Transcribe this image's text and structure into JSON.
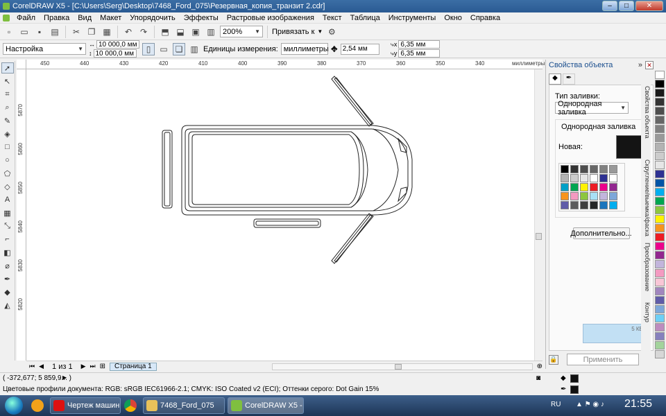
{
  "window": {
    "title": "CorelDRAW X5 - [C:\\Users\\Serg\\Desktop\\7468_Ford_075\\Резервная_копия_транзит 2.cdr]"
  },
  "menu": [
    "Файл",
    "Правка",
    "Вид",
    "Макет",
    "Упорядочить",
    "Эффекты",
    "Растровые изображения",
    "Текст",
    "Таблица",
    "Инструменты",
    "Окно",
    "Справка"
  ],
  "toolbar": {
    "zoom": "200%",
    "snap_label": "Привязать к"
  },
  "propbar": {
    "preset": "Настройка",
    "width": "10 000,0 мм",
    "height": "10 000,0 мм",
    "units_label": "Единицы измерения:",
    "units": "миллиметры",
    "nudge": "2,54 мм",
    "dup_x": "6,35 мм",
    "dup_y": "6,35 мм"
  },
  "ruler": {
    "top": [
      "450",
      "440",
      "430",
      "420",
      "410",
      "400",
      "390",
      "380",
      "370",
      "360",
      "350",
      "340"
    ],
    "units": "миллиметры",
    "left": [
      "5870",
      "5860",
      "5850",
      "5840",
      "5830",
      "5820"
    ]
  },
  "pager": {
    "pos": "1 из 1",
    "tab": "Страница 1"
  },
  "status": {
    "coords": "( -372,677; 5 859,9... )",
    "profile": "Цветовые профили документа: RGB: sRGB IEC61966-2.1; CMYK: ISO Coated v2 (ECI); Оттенки серого: Dot Gain 15%"
  },
  "docker": {
    "title": "Свойства объекта",
    "fill_type_label": "Тип заливки:",
    "fill_type": "Однородная заливка",
    "group_label": "Однородная заливка",
    "new_label": "Новая:",
    "more_button": "Дополнительно...",
    "apply_button": "Применить",
    "new_color": "#141414",
    "overlay_text": "5 КБ/с"
  },
  "docker_tabs": [
    "Свойства объекта",
    "Скругление/выемка/фаска",
    "Преобразование",
    "Контур"
  ],
  "swatches": [
    "#000000",
    "#333333",
    "#4d4d4d",
    "#666666",
    "#808080",
    "#999999",
    "#b3b3b3",
    "#cccccc",
    "#e6e6e6",
    "#ffffff",
    "#2e3192",
    "#ffffff",
    "#00a0c6",
    "#00a651",
    "#fff200",
    "#ed1c24",
    "#ec008c",
    "#92278f",
    "#f7941d",
    "#f49ac1",
    "#8dc63f",
    "#a8e0f5",
    "#c2b5dc",
    "#7da7d9",
    "#605ca8",
    "#5c5c5c",
    "#3f3f3f",
    "#262626",
    "#1b75bc",
    "#00aeef"
  ],
  "palette": [
    "#ffffff",
    "#000000",
    "#1a1a1a",
    "#333333",
    "#4d4d4d",
    "#666666",
    "#808080",
    "#999999",
    "#b3b3b3",
    "#cccccc",
    "#e6e6e6",
    "#2e3192",
    "#0054a6",
    "#00aeef",
    "#00a651",
    "#8dc63f",
    "#fff200",
    "#f7941d",
    "#ed1c24",
    "#ec008c",
    "#92278f",
    "#c2b5dc",
    "#f49ac1",
    "#f9c6d6",
    "#a186be",
    "#605ca8",
    "#7da7d9",
    "#6dcff6",
    "#bd8cbf",
    "#8781bd",
    "#a3d39c",
    "#d7d7d7"
  ],
  "taskbar": {
    "items": [
      "Чертеж машин...",
      "7468_Ford_075",
      "CorelDRAW X5 - ..."
    ],
    "lang": "RU",
    "time": "21:55"
  }
}
